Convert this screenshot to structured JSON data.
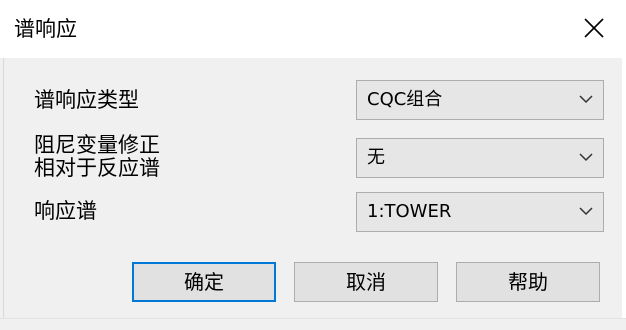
{
  "window": {
    "title": "谱响应",
    "close_glyph": "✕"
  },
  "form": {
    "rows": [
      {
        "label_line1": "谱响应类型",
        "label_line2": "",
        "value": "CQC组合"
      },
      {
        "label_line1": "阻尼变量修正",
        "label_line2": "相对于反应谱",
        "value": "无"
      },
      {
        "label_line1": "响应谱",
        "label_line2": "",
        "value": "1:TOWER"
      }
    ]
  },
  "buttons": {
    "ok": "确定",
    "cancel": "取消",
    "help": "帮助"
  },
  "colors": {
    "accent": "#0078d7",
    "dialog_bg": "#f0f0f0",
    "combo_bg": "#e6e6e6",
    "button_bg": "#e1e1e1",
    "border": "#adadad"
  },
  "icons": {
    "close": "close-icon",
    "dropdown": "chevron-down-icon"
  }
}
